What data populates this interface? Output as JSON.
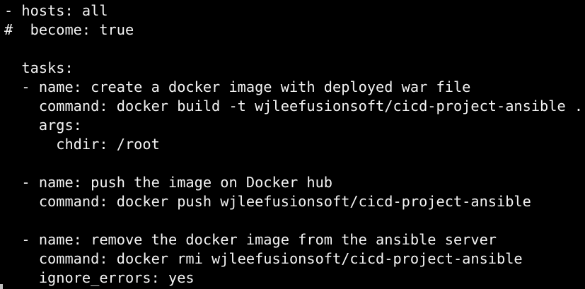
{
  "terminal": {
    "lines": [
      "- hosts: all",
      "#  become: true",
      "",
      "  tasks:",
      "  - name: create a docker image with deployed war file",
      "    command: docker build -t wjleefusionsoft/cicd-project-ansible .",
      "    args:",
      "      chdir: /root",
      "",
      "  - name: push the image on Docker hub",
      "    command: docker push wjleefusionsoft/cicd-project-ansible",
      "",
      "  - name: remove the docker image from the ansible server",
      "    command: docker rmi wjleefusionsoft/cicd-project-ansible",
      "    ignore_errors: yes"
    ]
  },
  "colors": {
    "background": "#000000",
    "text": "#f2f2f2"
  }
}
